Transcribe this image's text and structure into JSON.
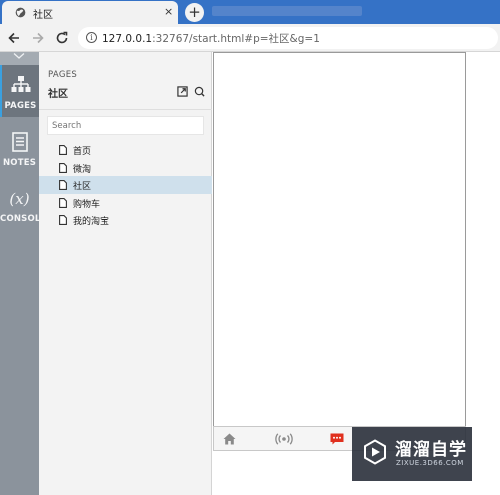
{
  "browser": {
    "tab_title": "社区",
    "tab_close": "×",
    "new_tab": "+",
    "url_host": "127.0.0.1",
    "url_path": ":32767/start.html#p=社区&g=1"
  },
  "rail": {
    "items": [
      {
        "label": "PAGES",
        "icon": "sitemap-icon",
        "active": true
      },
      {
        "label": "NOTES",
        "icon": "notes-icon",
        "active": false
      },
      {
        "label": "CONSOLE",
        "icon": "variable-x-icon",
        "glyph": "(x)",
        "active": false
      }
    ],
    "accent": "#3aa0e0"
  },
  "panel": {
    "heading": "PAGES",
    "title": "社区",
    "search_placeholder": "Search",
    "pages": [
      {
        "name": "首页",
        "selected": false
      },
      {
        "name": "微淘",
        "selected": false
      },
      {
        "name": "社区",
        "selected": true
      },
      {
        "name": "购物车",
        "selected": false
      },
      {
        "name": "我的淘宝",
        "selected": false
      }
    ]
  },
  "prototype": {
    "tabbar_icons": [
      "home-icon",
      "broadcast-icon",
      "message-icon"
    ],
    "message_color": "#e0301e"
  },
  "watermark": {
    "title": "溜溜自学",
    "subtitle": "ZIXUE.3D66.COM"
  }
}
